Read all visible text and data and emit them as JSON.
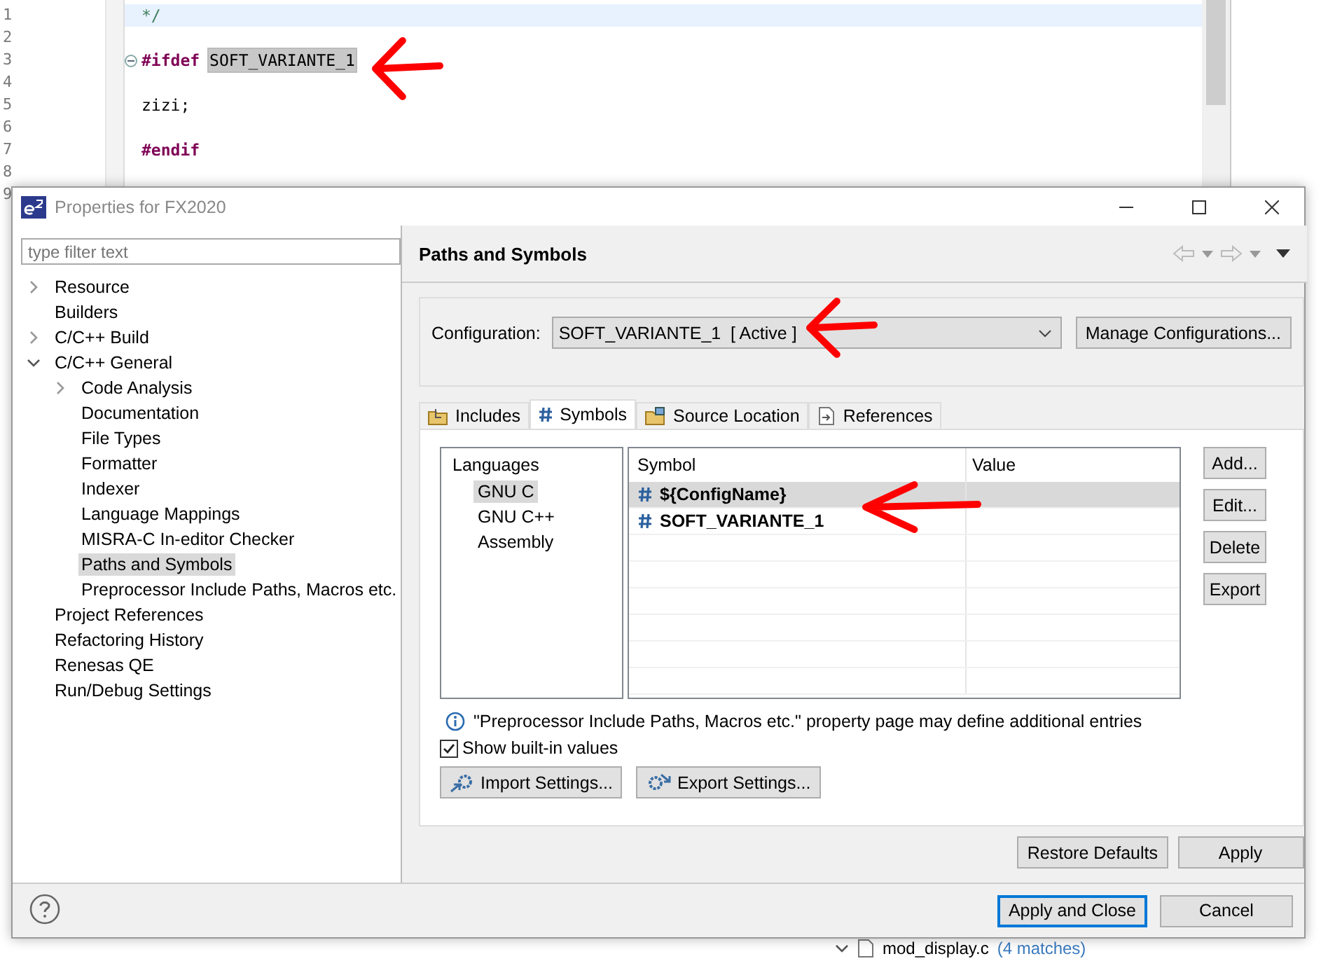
{
  "editor": {
    "lines": [
      {
        "number": "1",
        "kind": "comment",
        "text": "*/",
        "current": true
      },
      {
        "number": "2",
        "kind": "blank",
        "current": false
      },
      {
        "number": "3",
        "kind": "directive",
        "keyword": "#ifdef",
        "argument": "SOFT_VARIANTE_1",
        "highlighted": true,
        "foldable": true,
        "current": false
      },
      {
        "number": "4",
        "kind": "blank",
        "current": false
      },
      {
        "number": "5",
        "kind": "code",
        "text": "zizi;",
        "current": false
      },
      {
        "number": "6",
        "kind": "blank",
        "current": false
      },
      {
        "number": "7",
        "kind": "directive",
        "keyword": "#endif",
        "current": false
      },
      {
        "number": "8",
        "kind": "blank",
        "current": false
      },
      {
        "number": "9",
        "kind": "blank",
        "current": false
      }
    ]
  },
  "dialog": {
    "title": "Properties for FX2020",
    "filter": {
      "placeholder": "type filter text"
    },
    "tree": [
      {
        "label": "Resource",
        "expanded": false,
        "selected": false
      },
      {
        "label": "Builders",
        "selected": false
      },
      {
        "label": "C/C++ Build",
        "expanded": false,
        "selected": false
      },
      {
        "label": "C/C++ General",
        "expanded": true,
        "selected": false,
        "children": [
          {
            "label": "Code Analysis",
            "expanded": false,
            "selected": false
          },
          {
            "label": "Documentation",
            "selected": false
          },
          {
            "label": "File Types",
            "selected": false
          },
          {
            "label": "Formatter",
            "selected": false
          },
          {
            "label": "Indexer",
            "selected": false
          },
          {
            "label": "Language Mappings",
            "selected": false
          },
          {
            "label": "MISRA-C In-editor Checker",
            "selected": false
          },
          {
            "label": "Paths and Symbols",
            "selected": true
          },
          {
            "label": "Preprocessor Include Paths, Macros etc.",
            "selected": false
          }
        ]
      },
      {
        "label": "Project References",
        "selected": false
      },
      {
        "label": "Refactoring History",
        "selected": false
      },
      {
        "label": "Renesas QE",
        "selected": false
      },
      {
        "label": "Run/Debug Settings",
        "selected": false
      }
    ],
    "page_title": "Paths and Symbols",
    "configuration": {
      "label": "Configuration:",
      "value": "SOFT_VARIANTE_1  [ Active ]",
      "button": "Manage Configurations..."
    },
    "tabs": [
      {
        "label": "Includes",
        "kind": "includes",
        "selected": false
      },
      {
        "label": "Symbols",
        "kind": "symbols",
        "selected": true
      },
      {
        "label": "Source Location",
        "kind": "source",
        "selected": false
      },
      {
        "label": "References",
        "kind": "references",
        "selected": false
      }
    ],
    "languages": {
      "header": "Languages",
      "items": [
        {
          "label": "GNU C",
          "selected": true
        },
        {
          "label": "GNU C++",
          "selected": false
        },
        {
          "label": "Assembly",
          "selected": false
        }
      ]
    },
    "symbols": {
      "columns": [
        "Symbol",
        "Value"
      ],
      "rows": [
        {
          "symbol": "${ConfigName}",
          "selected": true
        },
        {
          "symbol": "SOFT_VARIANTE_1",
          "selected": false
        }
      ]
    },
    "side_buttons": [
      "Add...",
      "Edit...",
      "Delete",
      "Export"
    ],
    "info": "\"Preprocessor Include Paths, Macros etc.\" property page may define additional entries",
    "show_builtin": {
      "label": "Show built-in values",
      "checked": true
    },
    "settings_buttons": [
      {
        "label": "Import Settings...",
        "kind": "import"
      },
      {
        "label": "Export Settings...",
        "kind": "export"
      }
    ],
    "page_buttons": [
      "Restore Defaults",
      "Apply"
    ],
    "footer_buttons": [
      {
        "label": "Apply and Close",
        "default": true
      },
      {
        "label": "Cancel",
        "default": false
      }
    ]
  },
  "search_result": {
    "file": "mod_display.c",
    "matches": "(4 matches)"
  }
}
